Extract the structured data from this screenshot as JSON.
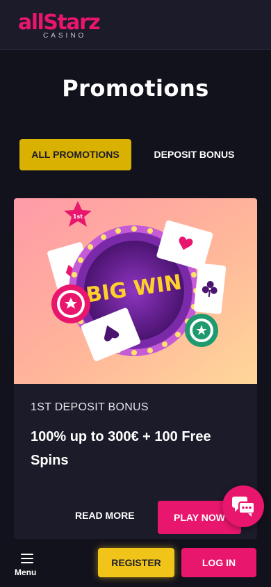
{
  "brand": {
    "logo_text": "allStarz",
    "logo_sub": "CASINO",
    "accent": "#e8166c",
    "gold": "#d9b100"
  },
  "page": {
    "title": "Promotions"
  },
  "tabs": [
    {
      "label": "ALL PROMOTIONS",
      "active": true
    },
    {
      "label": "DEPOSIT BONUS",
      "active": false
    }
  ],
  "promo_card": {
    "image_text": "BIG WIN",
    "badge_text": "1st",
    "label": "1ST DEPOSIT BONUS",
    "title": "100% up to 300€ + 100 Free Spins",
    "read_more_label": "READ MORE",
    "play_now_label": "PLAY NOW"
  },
  "chat": {
    "icon": "chat-icon"
  },
  "bottom_bar": {
    "menu_label": "Menu",
    "register_label": "REGISTER",
    "login_label": "LOG IN"
  }
}
